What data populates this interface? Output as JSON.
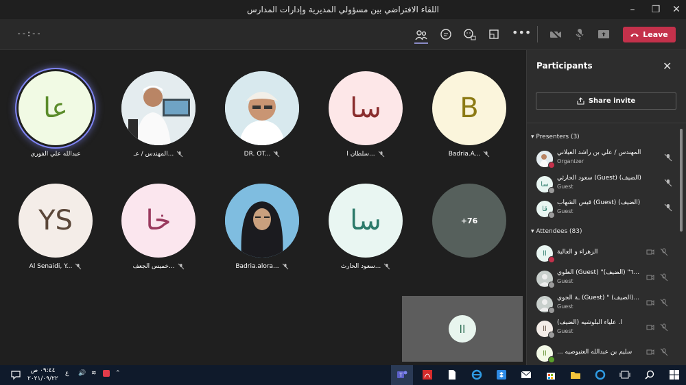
{
  "window": {
    "title": "اللقاء الافتراضي بين مسؤولي المديرية وإدارات المدارس"
  },
  "toolbar": {
    "timer": "--:--",
    "leave_label": "Leave"
  },
  "tiles": [
    {
      "initials": "عا",
      "name": "عبدالله علي الفوري",
      "bg": "#f1fae4",
      "fg": "#5b8c2a",
      "photo": false
    },
    {
      "initials": "",
      "name": "المهندس / عـ...",
      "bg": "#dfe8ee",
      "fg": "#333",
      "photo": true
    },
    {
      "initials": "",
      "name": "DR. OT...",
      "bg": "#cfe4ec",
      "fg": "#333",
      "photo": true
    },
    {
      "initials": "سا",
      "name": "سلطان ا...",
      "bg": "#fde7e8",
      "fg": "#8a2d2d",
      "photo": false
    },
    {
      "initials": "B",
      "name": "Badria.A...",
      "bg": "#fbf5dc",
      "fg": "#8c7a14",
      "photo": false
    },
    {
      "initials": "YS",
      "name": "Al Senaidi, Y...",
      "bg": "#f4ede8",
      "fg": "#5a4638",
      "photo": false
    },
    {
      "initials": "خا",
      "name": "خميس الجعف...",
      "bg": "#fbe6ee",
      "fg": "#9a3a5e",
      "photo": false
    },
    {
      "initials": "",
      "name": "Badria.alora...",
      "bg": "#6fb0d8",
      "fg": "#fff",
      "photo": true
    },
    {
      "initials": "سا",
      "name": "سعود الحارث...",
      "bg": "#e9f6f2",
      "fg": "#2c7a6a",
      "photo": false
    },
    {
      "initials": "+76",
      "name": "",
      "bg": "#56605c",
      "fg": "#fff",
      "photo": false
    }
  ],
  "self_view": {
    "initials": "اا"
  },
  "panel": {
    "title": "Participants",
    "share_label": "Share invite",
    "presenters_label": "Presenters (3)",
    "attendees_label": "Attendees (83)",
    "presenters": [
      {
        "name": "المهندس / علي بن راشد العيلاني",
        "role": "Organizer",
        "initials": "",
        "avbg": "#dfe8ee",
        "status": "#c4314b"
      },
      {
        "name": "سعود الحارثي (Guest) (الضيف)",
        "role": "Guest",
        "initials": "سا",
        "avbg": "#e9f6f2",
        "status": "#9a9a9a"
      },
      {
        "name": "قيس الشهاب (Guest) (الضيف)",
        "role": "Guest",
        "initials": "قا",
        "avbg": "#e9f6f2",
        "status": "#9a9a9a"
      }
    ],
    "attendees": [
      {
        "name": "الزهراء و العالية",
        "role": "",
        "initials": "اا",
        "avbg": "#e9f6f2",
        "status": "#c4314b"
      },
      {
        "name": "العلوي (Guest) \"٦\" (الضيف)...",
        "role": "Guest",
        "initials": "",
        "avbg": "#c8cfcc",
        "status": "#9a9a9a"
      },
      {
        "name": "ـة الجوي (Guest) \" (الضيف)...",
        "role": "Guest",
        "initials": "",
        "avbg": "#c8cfcc",
        "status": "#9a9a9a"
      },
      {
        "name": "أ. علياء البلوشيه (الضيف)",
        "role": "Guest",
        "initials": "اا",
        "avbg": "#f4ede8",
        "status": "#9a9a9a"
      },
      {
        "name": "... سليم بن عبدالله العنبوصيه",
        "role": "",
        "initials": "اا",
        "avbg": "#f3f9e6",
        "status": "#5aa02c"
      }
    ]
  },
  "taskbar": {
    "time": "٠٩:٤٤ ص",
    "date": "٢٠٢١/٠٩/٢٢",
    "lang": "ع"
  },
  "colors": {
    "accent": "#7f85f5",
    "leave": "#c4314b"
  }
}
